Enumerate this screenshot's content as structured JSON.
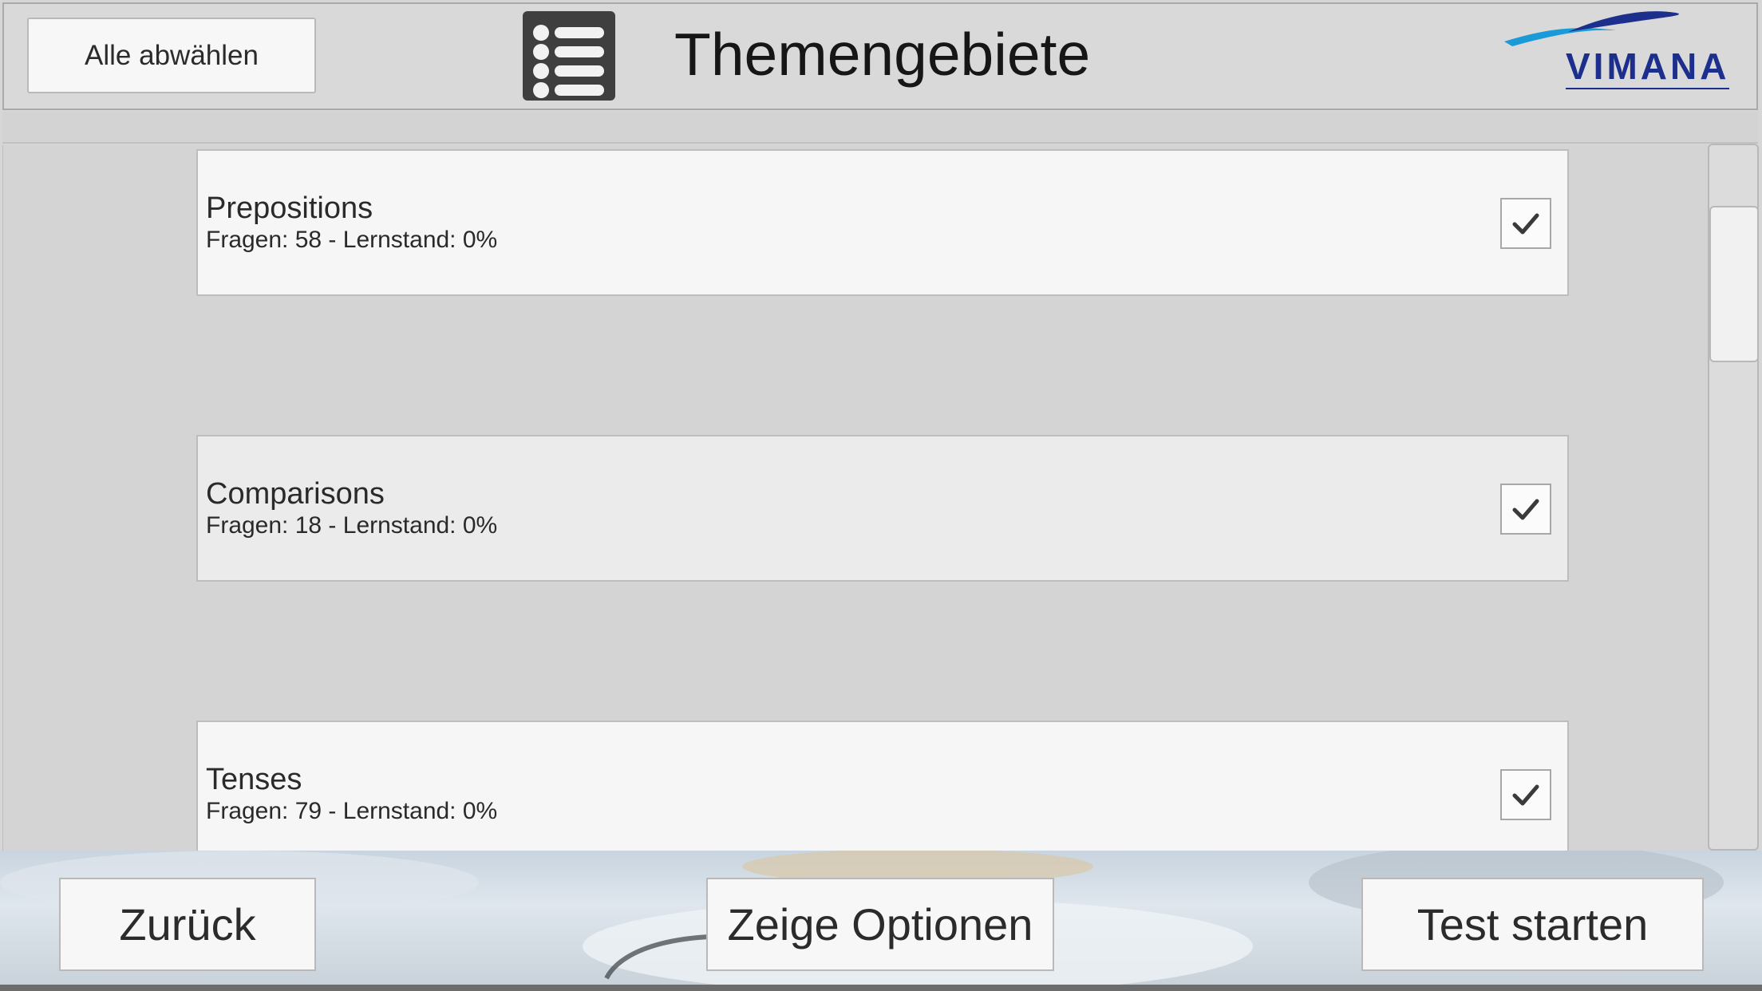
{
  "header": {
    "deselect_all_label": "Alle abwählen",
    "title": "Themengebiete",
    "logo_text": "VIMANA"
  },
  "topics": [
    {
      "name": "Prepositions",
      "stats": "Fragen: 58 - Lernstand: 0%",
      "checked": true
    },
    {
      "name": "Comparisons",
      "stats": "Fragen: 18 - Lernstand: 0%",
      "checked": true
    },
    {
      "name": "Tenses",
      "stats": "Fragen: 79 - Lernstand: 0%",
      "checked": true
    }
  ],
  "footer": {
    "back_label": "Zurück",
    "options_label": "Zeige Optionen",
    "start_label": "Test starten"
  },
  "colors": {
    "logo_dark_blue": "#1d2f8c",
    "logo_light_blue": "#1a9ad6",
    "icon_dark": "#3f3f3f"
  }
}
